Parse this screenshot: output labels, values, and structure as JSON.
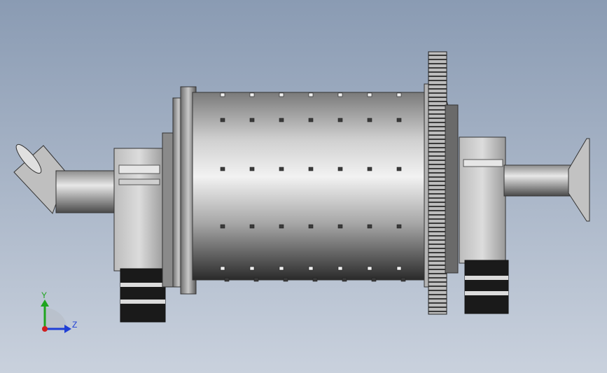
{
  "viewport": {
    "background_top": "#8a9bb3",
    "background_bottom": "#c9d1dd"
  },
  "model": {
    "name": "ball-mill-assembly"
  },
  "triad": {
    "y_label": "Y",
    "z_label": "Z",
    "y_color": "#1fa51f",
    "z_color": "#1f3fd6",
    "origin_color": "#d01f1f"
  }
}
